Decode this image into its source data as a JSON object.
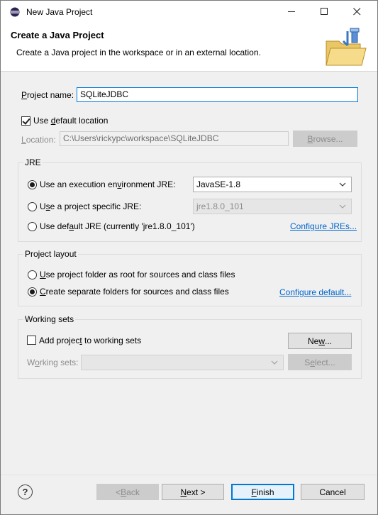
{
  "window": {
    "title": "New Java Project",
    "minimize": "—",
    "maximize": "☐",
    "close": "✕"
  },
  "header": {
    "title": "Create a Java Project",
    "description": "Create a Java project in the workspace or in an external location."
  },
  "project": {
    "name_label": "Project name:",
    "name_value": "SQLiteJDBC"
  },
  "location": {
    "use_default_label": "Use default location",
    "use_default_checked": true,
    "location_label": "Location:",
    "location_value": "C:\\Users\\rickypc\\workspace\\SQLiteJDBC",
    "browse_label": "Browse..."
  },
  "jre": {
    "group_title": "JRE",
    "option_env_label": "Use an execution environment JRE:",
    "option_env_selected": "JavaSE-1.8",
    "option_specific_label": "Use a project specific JRE:",
    "option_specific_selected": "jre1.8.0_101",
    "option_default_label": "Use default JRE (currently 'jre1.8.0_101')",
    "configure_link": "Configure JREs...",
    "selected_option": "env"
  },
  "layout": {
    "group_title": "Project layout",
    "option_root_label": "Use project folder as root for sources and class files",
    "option_separate_label": "Create separate folders for sources and class files",
    "configure_link": "Configure default...",
    "selected_option": "separate"
  },
  "working_sets": {
    "group_title": "Working sets",
    "add_label": "Add project to working sets",
    "add_checked": false,
    "new_button": "New...",
    "sets_label": "Working sets:",
    "select_button": "Select..."
  },
  "footer": {
    "help": "?",
    "back": "< Back",
    "next": "Next >",
    "finish": "Finish",
    "cancel": "Cancel"
  },
  "colors": {
    "accent": "#0078d7",
    "link": "#0066cc",
    "dialog_bg": "#f0f0f0"
  }
}
